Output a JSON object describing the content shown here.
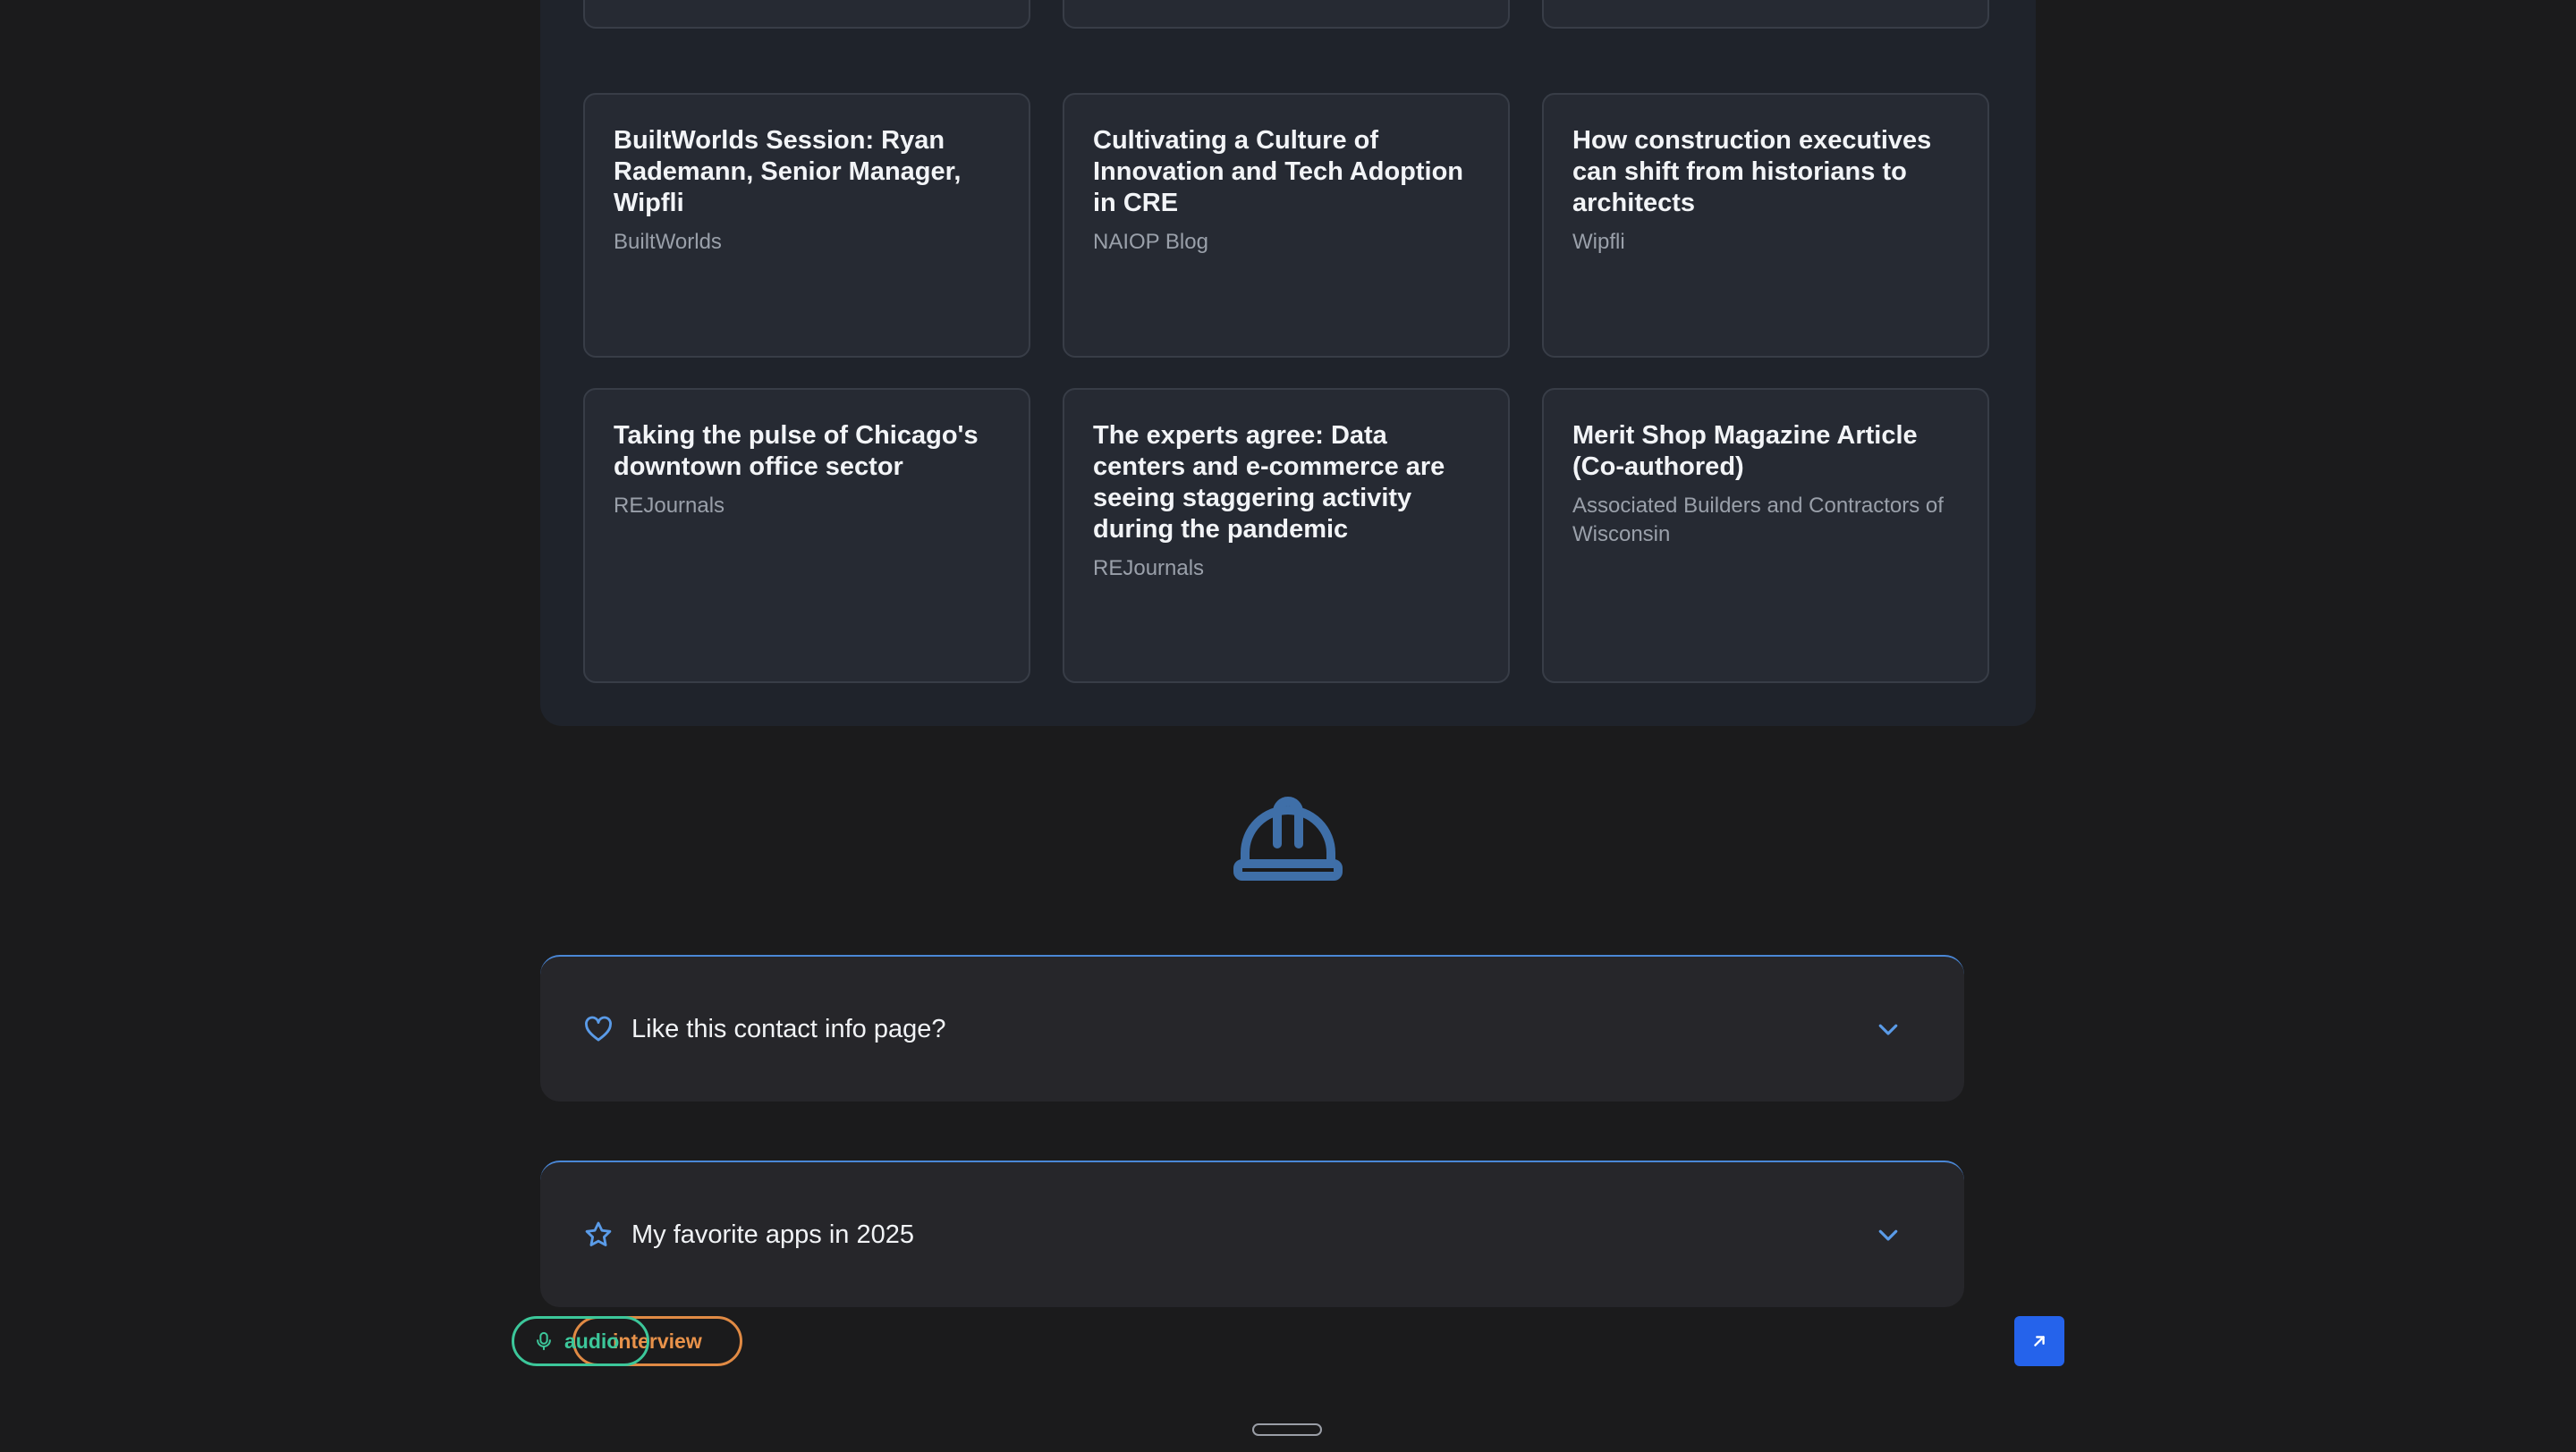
{
  "articles": [
    {
      "title": "BuiltWorlds Session: Ryan Rademann, Senior Manager, Wipfli",
      "source": "BuiltWorlds"
    },
    {
      "title": "Cultivating a Culture of Innovation and Tech Adoption in CRE",
      "source": "NAIOP Blog"
    },
    {
      "title": "How construction executives can shift from historians to architects",
      "source": "Wipfli"
    },
    {
      "title": "Taking the pulse of Chicago's downtown office sector",
      "source": "REJournals"
    },
    {
      "title": "The experts agree: Data centers and e-commerce are seeing staggering activity during the pandemic",
      "source": "REJournals"
    },
    {
      "title": "Merit Shop Magazine Article (Co-authored)",
      "source": "Associated Builders and Contractors of Wisconsin"
    }
  ],
  "divider_icon": "hard-hat-icon",
  "accordions": [
    {
      "icon": "heart-icon",
      "title": "Like this contact info page?"
    },
    {
      "icon": "star-icon",
      "title": "My favorite apps in 2025"
    }
  ],
  "pills": {
    "interview_label": "interview",
    "audio_label": "audio"
  },
  "colors": {
    "accent_blue": "#4a87d6",
    "orange": "#e08a44",
    "green": "#3cc79a",
    "button_blue": "#2563eb"
  }
}
